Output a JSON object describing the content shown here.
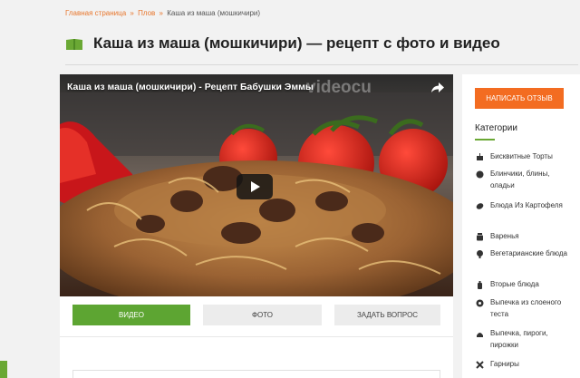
{
  "breadcrumb": {
    "home": "Главная страница",
    "sep1": "»",
    "section": "Плов",
    "sep2": "»",
    "current": "Каша из маша (мошкичири)"
  },
  "page": {
    "title": "Каша из маша (мошкичири) — рецепт с фото и видео"
  },
  "video": {
    "title": "Каша из маша (мошкичири) - Рецепт Бабушки Эммы",
    "watermark": "videocu"
  },
  "tabs": [
    {
      "label": "ВИДЕО",
      "active": true
    },
    {
      "label": "ФОТО",
      "active": false
    },
    {
      "label": "ЗАДАТЬ ВОПРОС",
      "active": false
    }
  ],
  "sidebar": {
    "review_button": "НАПИСАТЬ ОТЗЫВ",
    "categories_heading": "Категории",
    "categories": [
      {
        "label": "Бисквитные Торты",
        "icon": "cake-icon"
      },
      {
        "label": "Блинчики, блины, оладьи",
        "icon": "pancake-icon"
      },
      {
        "label": "Блюда Из Картофеля",
        "icon": "potato-icon"
      },
      {
        "label": "Варенья",
        "icon": "jam-jar-icon"
      },
      {
        "label": "Вегетарианские блюда",
        "icon": "broccoli-icon"
      },
      {
        "label": "Вторые блюда",
        "icon": "bottle-icon"
      },
      {
        "label": "Выпечка из слоеного теста",
        "icon": "pastry-icon"
      },
      {
        "label": "Выпечка, пироги, пирожки",
        "icon": "pie-icon"
      },
      {
        "label": "Гарниры",
        "icon": "garnish-icon"
      }
    ]
  },
  "colors": {
    "accent_orange": "#f36c21",
    "link_orange": "#e8762c",
    "green": "#5da532"
  }
}
